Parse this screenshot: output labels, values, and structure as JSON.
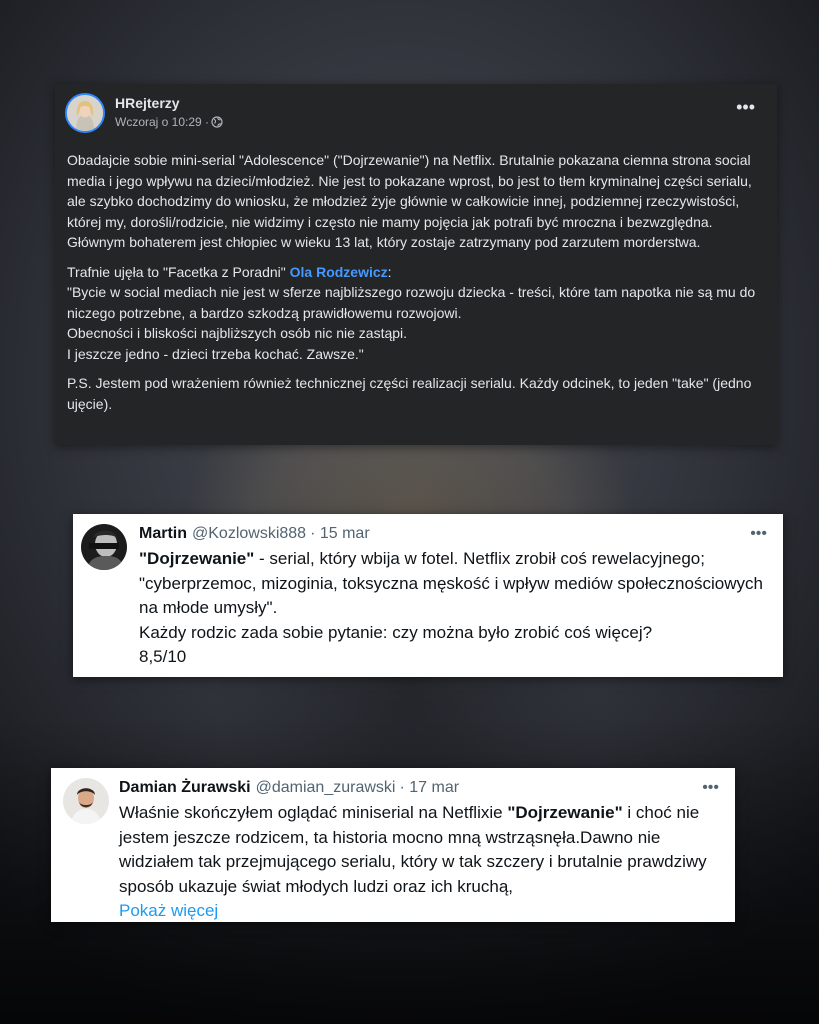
{
  "facebook_post": {
    "author": "HRejterzy",
    "time": "Wczoraj o 10:29 ·",
    "menu": "•••",
    "paragraph1": "Obadajcie sobie mini-serial \"Adolescence\" (\"Dojrzewanie\") na Netflix. Brutalnie pokazana ciemna strona social media i jego wpływu na dzieci/młodzież. Nie jest to pokazane wprost, bo jest to tłem kryminalnej części serialu, ale szybko dochodzimy do wniosku, że młodzież żyje głównie w całkowicie innej, podziemnej rzeczywistości, której my, dorośli/rodzicie, nie widzimy i często nie mamy pojęcia jak potrafi być mroczna i bezwzględna. Głównym bohaterem jest chłopiec w wieku 13 lat, który zostaje zatrzymany pod zarzutem morderstwa.",
    "paragraph2_intro": "Trafnie ujęła to \"Facetka z Poradni\" ",
    "paragraph2_mention": "Ola Rodzewicz",
    "paragraph2_colon": ":",
    "paragraph2_quote": "\"Bycie w social mediach nie jest w sferze najbliższego rozwoju dziecka - treści, które tam napotka nie są mu do niczego potrzebne, a bardzo szkodzą prawidłowemu rozwojowi.\nObecności i bliskości najbliższych osób nic nie zastąpi.\nI jeszcze jedno - dzieci trzeba kochać. Zawsze.\"",
    "paragraph3": "P.S. Jestem pod wrażeniem również technicznej części realizacji serialu. Każdy odcinek, to jeden \"take\" (jedno ujęcie).",
    "audience_icon": "globe-icon"
  },
  "tweet1": {
    "name": "Martin",
    "handle": "@Kozlowski888",
    "date": "· 15 mar",
    "menu": "•••",
    "title_bold": "\"Dojrzewanie\"",
    "text_rest": " - serial, który wbija w fotel. Netflix zrobił coś rewelacyjnego; \"cyberprzemoc, mizoginia, toksyczna męskość i wpływ mediów społecznościowych na młode umysły\".\nKażdy rodzic zada sobie pytanie: czy można było zrobić coś więcej?\n8,5/10"
  },
  "tweet2": {
    "name": "Damian Żurawski",
    "handle": "@damian_zurawski",
    "date": "· 17 mar",
    "menu": "•••",
    "text_before": "Właśnie skończyłem oglądać miniserial na Netflixie ",
    "title_bold": "\"Dojrzewanie\"",
    "text_after": " i choć nie jestem jeszcze rodzicem, ta historia mocno mną wstrząsnęła.Dawno nie widziałem tak przejmującego serialu, który w tak szczery i brutalnie prawdziwy sposób ukazuje świat młodych ludzi oraz ich kruchą,",
    "show_more": "Pokaż więcej"
  },
  "colors": {
    "fb_background": "#242526",
    "fb_text": "#e4e6eb",
    "fb_mention": "#4599ff",
    "tweet_background": "#ffffff",
    "tweet_secondary": "#536471",
    "tweet_link": "#1d9bf0"
  }
}
